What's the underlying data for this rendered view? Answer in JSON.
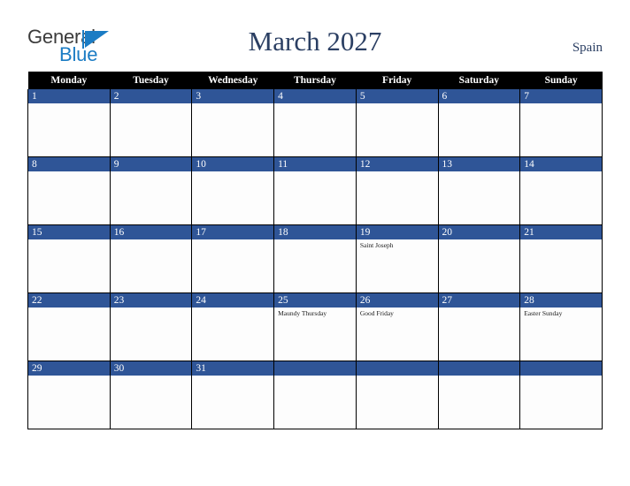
{
  "header": {
    "logo": {
      "text_primary": "General",
      "text_secondary": "Blue",
      "primary_color": "#3b3b3b",
      "secondary_color": "#1b7cc4",
      "triangle_icon": "triangle-icon"
    },
    "title": "March 2027",
    "country": "Spain",
    "title_color": "#2b3f63"
  },
  "colors": {
    "weekday_header_bg": "#000000",
    "weekday_header_text": "#ffffff",
    "day_number_bar": "#2f5597",
    "day_number_text": "#ffffff",
    "cell_bg": "#fdfdfd",
    "cell_border": "#000000",
    "holiday_text": "#1a1a1a"
  },
  "calendar": {
    "month": "March",
    "year": "2027",
    "weekday_headers": [
      "Monday",
      "Tuesday",
      "Wednesday",
      "Thursday",
      "Friday",
      "Saturday",
      "Sunday"
    ],
    "weeks": [
      [
        {
          "day": "1",
          "holidays": []
        },
        {
          "day": "2",
          "holidays": []
        },
        {
          "day": "3",
          "holidays": []
        },
        {
          "day": "4",
          "holidays": []
        },
        {
          "day": "5",
          "holidays": []
        },
        {
          "day": "6",
          "holidays": []
        },
        {
          "day": "7",
          "holidays": []
        }
      ],
      [
        {
          "day": "8",
          "holidays": []
        },
        {
          "day": "9",
          "holidays": []
        },
        {
          "day": "10",
          "holidays": []
        },
        {
          "day": "11",
          "holidays": []
        },
        {
          "day": "12",
          "holidays": []
        },
        {
          "day": "13",
          "holidays": []
        },
        {
          "day": "14",
          "holidays": []
        }
      ],
      [
        {
          "day": "15",
          "holidays": []
        },
        {
          "day": "16",
          "holidays": []
        },
        {
          "day": "17",
          "holidays": []
        },
        {
          "day": "18",
          "holidays": []
        },
        {
          "day": "19",
          "holidays": [
            "Saint Joseph"
          ]
        },
        {
          "day": "20",
          "holidays": []
        },
        {
          "day": "21",
          "holidays": []
        }
      ],
      [
        {
          "day": "22",
          "holidays": []
        },
        {
          "day": "23",
          "holidays": []
        },
        {
          "day": "24",
          "holidays": []
        },
        {
          "day": "25",
          "holidays": [
            "Maundy Thursday"
          ]
        },
        {
          "day": "26",
          "holidays": [
            "Good Friday"
          ]
        },
        {
          "day": "27",
          "holidays": []
        },
        {
          "day": "28",
          "holidays": [
            "Easter Sunday"
          ]
        }
      ],
      [
        {
          "day": "29",
          "holidays": []
        },
        {
          "day": "30",
          "holidays": []
        },
        {
          "day": "31",
          "holidays": []
        },
        {
          "day": "",
          "holidays": []
        },
        {
          "day": "",
          "holidays": []
        },
        {
          "day": "",
          "holidays": []
        },
        {
          "day": "",
          "holidays": []
        }
      ]
    ]
  }
}
